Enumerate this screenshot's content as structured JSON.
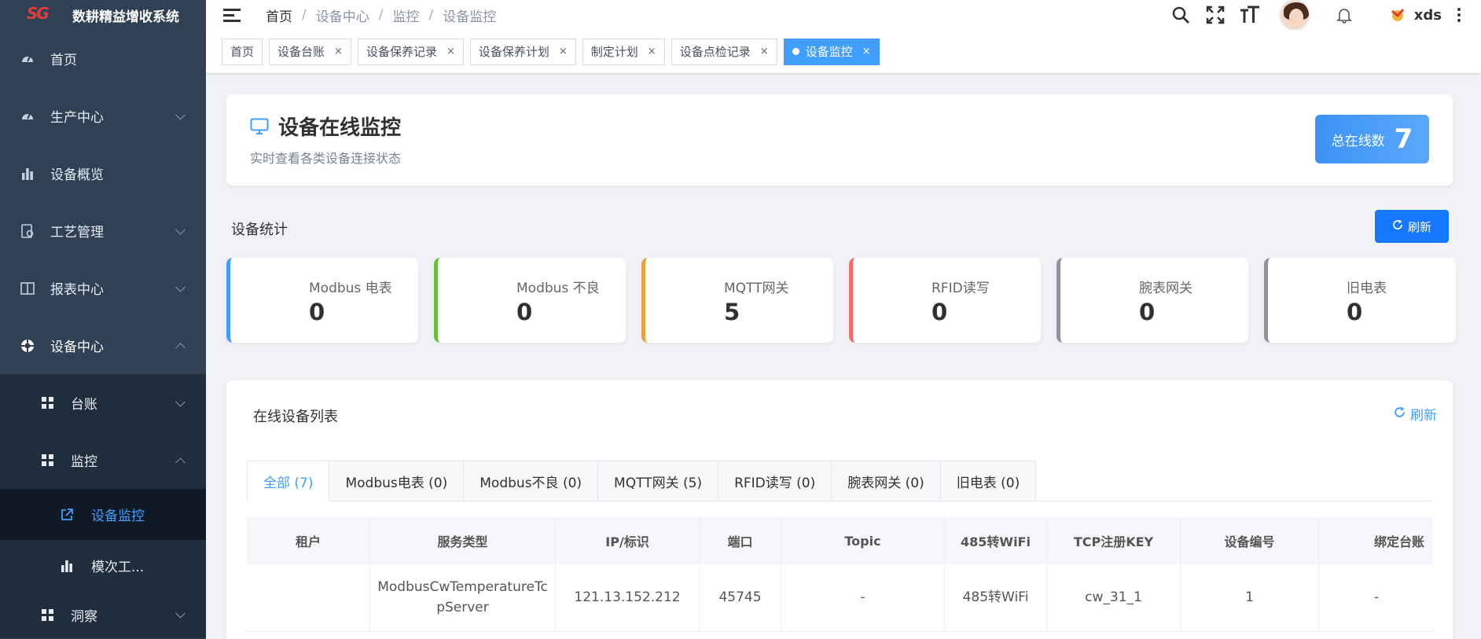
{
  "app": {
    "logo_text": "SG",
    "title": "数耕精益增收系统"
  },
  "sidebar": {
    "items": [
      {
        "label": "首页",
        "icon": "dashboard-icon"
      },
      {
        "label": "生产中心",
        "icon": "dashboard-icon"
      },
      {
        "label": "设备概览",
        "icon": "bar-chart-icon"
      },
      {
        "label": "工艺管理",
        "icon": "document-icon"
      },
      {
        "label": "报表中心",
        "icon": "book-icon"
      },
      {
        "label": "设备中心",
        "icon": "life-ring-icon"
      }
    ],
    "sub_items": [
      {
        "label": "台账"
      },
      {
        "label": "监控"
      }
    ],
    "sub_sub_items": [
      {
        "label": "设备监控"
      },
      {
        "label": "模次工..."
      }
    ],
    "bottom_item": {
      "label": "洞察"
    }
  },
  "header": {
    "breadcrumb": [
      "首页",
      "设备中心",
      "监控",
      "设备监控"
    ],
    "separator": "/",
    "user_name": "xds"
  },
  "tags": [
    {
      "label": "首页",
      "closable": false
    },
    {
      "label": "设备台账",
      "closable": true
    },
    {
      "label": "设备保养记录",
      "closable": true
    },
    {
      "label": "设备保养计划",
      "closable": true
    },
    {
      "label": "制定计划",
      "closable": true
    },
    {
      "label": "设备点检记录",
      "closable": true
    },
    {
      "label": "设备监控",
      "closable": true,
      "active": true
    }
  ],
  "close_glyph": "×",
  "page": {
    "title": "设备在线监控",
    "subtitle": "实时查看各类设备连接状态",
    "online_label": "总在线数",
    "online_count": "7"
  },
  "stats": {
    "title": "设备统计",
    "refresh_label": "刷新",
    "cards": [
      {
        "label": "Modbus 电表",
        "value": "0",
        "color": "#409eff"
      },
      {
        "label": "Modbus 不良",
        "value": "0",
        "color": "#67c23a"
      },
      {
        "label": "MQTT网关",
        "value": "5",
        "color": "#e6a23c"
      },
      {
        "label": "RFID读写",
        "value": "0",
        "color": "#f56c6c"
      },
      {
        "label": "腕表网关",
        "value": "0",
        "color": "#909399"
      },
      {
        "label": "旧电表",
        "value": "0",
        "color": "#909399"
      }
    ]
  },
  "list": {
    "title": "在线设备列表",
    "refresh_label": "刷新",
    "tabs": [
      {
        "label": "全部 (7)",
        "active": true
      },
      {
        "label": "Modbus电表 (0)"
      },
      {
        "label": "Modbus不良 (0)"
      },
      {
        "label": "MQTT网关 (5)"
      },
      {
        "label": "RFID读写 (0)"
      },
      {
        "label": "腕表网关 (0)"
      },
      {
        "label": "旧电表 (0)"
      }
    ],
    "columns": [
      "租户",
      "服务类型",
      "IP/标识",
      "端口",
      "Topic",
      "485转WiFi",
      "TCP注册KEY",
      "设备编号",
      "绑定台账"
    ],
    "rows": [
      [
        "",
        "ModbusCwTemperatureTcpServer",
        "121.13.152.212",
        "45745",
        "-",
        "485转WiFi",
        "cw_31_1",
        "1",
        "-"
      ]
    ]
  },
  "colors": {
    "primary": "#409eff",
    "sidebar_bg": "#304156",
    "sidebar_active_bg": "#0f1a26"
  }
}
